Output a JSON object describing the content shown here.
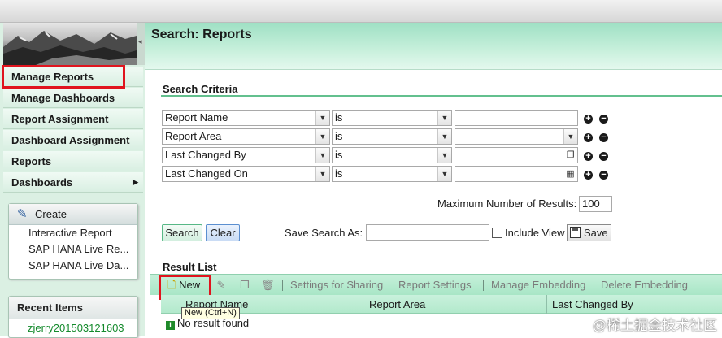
{
  "sidebar": {
    "nav": [
      {
        "label": "Manage Reports"
      },
      {
        "label": "Manage Dashboards"
      },
      {
        "label": "Report Assignment"
      },
      {
        "label": "Dashboard Assignment"
      },
      {
        "label": "Reports"
      },
      {
        "label": "Dashboards",
        "has_submenu": true
      }
    ],
    "create": {
      "title": "Create",
      "items": [
        "Interactive Report",
        "SAP HANA Live Re...",
        "SAP HANA Live Da..."
      ]
    },
    "recent": {
      "title": "Recent Items",
      "items": [
        "zjerry201503121603"
      ]
    }
  },
  "page_title": "Search: Reports",
  "search": {
    "title": "Search Criteria",
    "rows": [
      {
        "field": "Report Name",
        "operator": "is",
        "value": "",
        "control": "text"
      },
      {
        "field": "Report Area",
        "operator": "is",
        "value": "",
        "control": "dropdown"
      },
      {
        "field": "Last Changed By",
        "operator": "is",
        "value": "",
        "control": "picker"
      },
      {
        "field": "Last Changed On",
        "operator": "is",
        "value": "",
        "control": "date"
      }
    ],
    "max_results_label": "Maximum Number of Results:",
    "max_results_value": "100",
    "search_button": "Search",
    "clear_button": "Clear",
    "save_search_as_label": "Save Search As:",
    "save_search_as_value": "",
    "include_view_label": "Include View",
    "include_view_checked": false,
    "save_button": "Save"
  },
  "results": {
    "title": "Result List",
    "toolbar": {
      "new": "New",
      "settings_for_sharing": "Settings for Sharing",
      "report_settings": "Report Settings",
      "manage_embedding": "Manage Embedding",
      "delete_embedding": "Delete Embedding"
    },
    "tooltip": "New (Ctrl+N)",
    "columns": [
      "Report Name",
      "Report Area",
      "Last Changed By"
    ],
    "empty_message": "No result found"
  },
  "watermark": "@稀土掘金技术社区",
  "colors": {
    "accent": "#63c08e",
    "highlight_box": "#e0141e",
    "link": "#148a2c"
  }
}
